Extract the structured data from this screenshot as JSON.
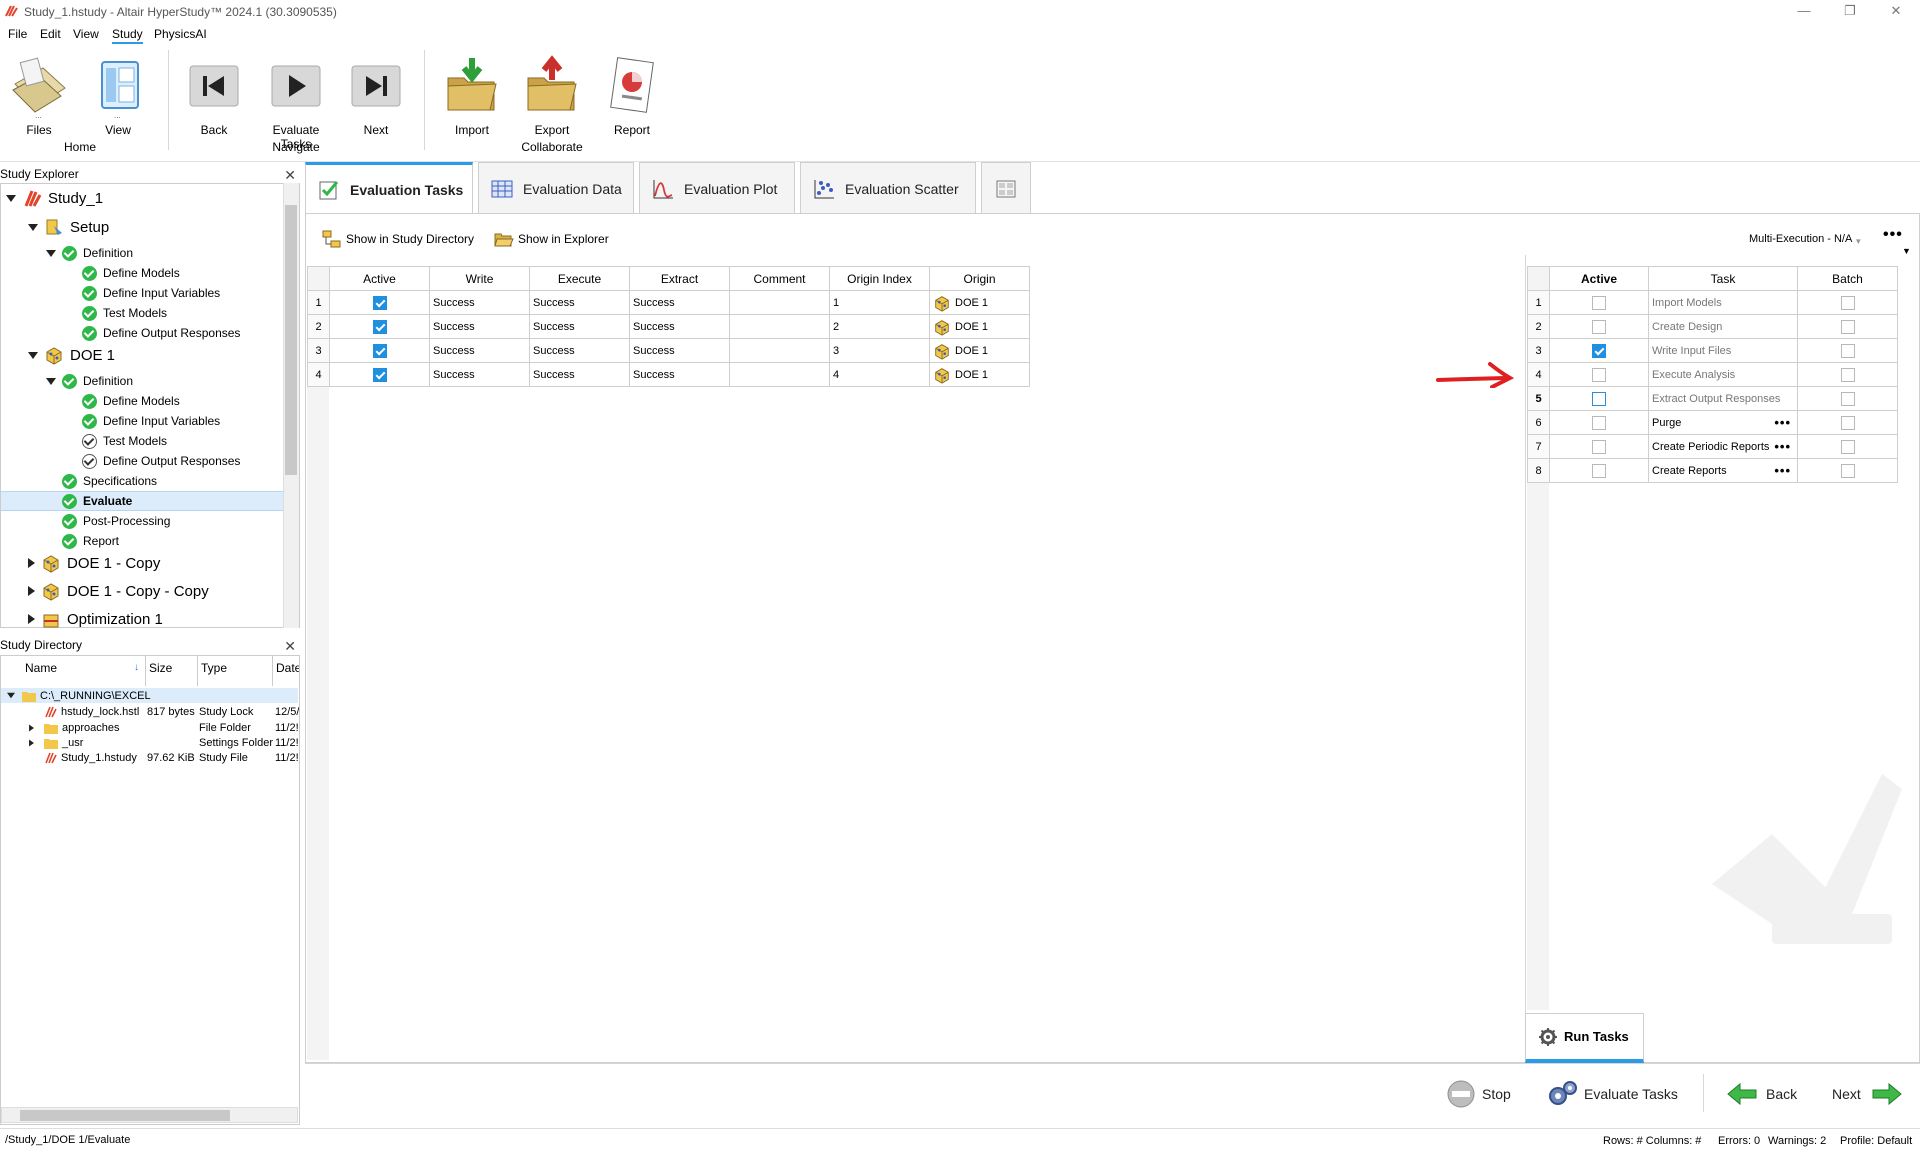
{
  "window": {
    "title": "Study_1.hstudy - Altair HyperStudy™ 2024.1 (30.3090535)",
    "controls": [
      "—",
      "❐",
      "✕"
    ]
  },
  "menu": [
    "File",
    "Edit",
    "View",
    "Study",
    "PhysicsAI"
  ],
  "ribbon": {
    "files": "Files",
    "view": "View",
    "home_group": "Home",
    "back": "Back",
    "evaluate_tasks": "Evaluate Tasks",
    "next": "Next",
    "navigate_group": "Navigate",
    "import": "Import",
    "export": "Export",
    "report": "Report",
    "collaborate_group": "Collaborate"
  },
  "explorer": {
    "header": "Study Explorer",
    "study": "Study_1",
    "setup": "Setup",
    "setup_definition": "Definition",
    "setup_items": [
      "Define Models",
      "Define Input Variables",
      "Test Models",
      "Define Output Responses"
    ],
    "doe": "DOE 1",
    "doe_definition": "Definition",
    "doe_items": [
      "Define Models",
      "Define Input Variables",
      "Test Models",
      "Define Output Responses"
    ],
    "specifications": "Specifications",
    "evaluate": "Evaluate",
    "post": "Post-Processing",
    "report": "Report",
    "doe_copy": "DOE 1 - Copy",
    "doe_copy_copy": "DOE 1 - Copy - Copy",
    "optimization": "Optimization 1"
  },
  "directory": {
    "header": "Study Directory",
    "columns": [
      "Name",
      "Size",
      "Type",
      "Date"
    ],
    "root": "C:\\_RUNNING\\EXCEL",
    "files": [
      {
        "name": "hstudy_lock.hstl",
        "size": "817 bytes",
        "type": "Study Lock",
        "date": "12/5/"
      },
      {
        "name": "approaches",
        "size": "",
        "type": "File Folder",
        "date": "11/2!"
      },
      {
        "name": "_usr",
        "size": "",
        "type": "Settings Folder",
        "date": "11/2!"
      },
      {
        "name": "Study_1.hstudy",
        "size": "97.62 KiB",
        "type": "Study File",
        "date": "11/2!"
      }
    ]
  },
  "tabs": [
    "Evaluation Tasks",
    "Evaluation Data",
    "Evaluation Plot",
    "Evaluation Scatter"
  ],
  "toolbar": {
    "show_study_dir": "Show in Study Directory",
    "show_explorer": "Show in Explorer",
    "multi_exec": "Multi-Execution - N/A"
  },
  "eval_table": {
    "columns": [
      "Active",
      "Write",
      "Execute",
      "Extract",
      "Comment",
      "Origin Index",
      "Origin"
    ],
    "rows": [
      {
        "n": "1",
        "write": "Success",
        "execute": "Success",
        "extract": "Success",
        "comment": "",
        "index": "1",
        "origin": "DOE 1"
      },
      {
        "n": "2",
        "write": "Success",
        "execute": "Success",
        "extract": "Success",
        "comment": "",
        "index": "2",
        "origin": "DOE 1"
      },
      {
        "n": "3",
        "write": "Success",
        "execute": "Success",
        "extract": "Success",
        "comment": "",
        "index": "3",
        "origin": "DOE 1"
      },
      {
        "n": "4",
        "write": "Success",
        "execute": "Success",
        "extract": "Success",
        "comment": "",
        "index": "4",
        "origin": "DOE 1"
      }
    ]
  },
  "task_table": {
    "columns": [
      "Active",
      "Task",
      "Batch"
    ],
    "rows": [
      {
        "n": "1",
        "task": "Import Models",
        "active": false
      },
      {
        "n": "2",
        "task": "Create Design",
        "active": false
      },
      {
        "n": "3",
        "task": "Write Input Files",
        "active": true
      },
      {
        "n": "4",
        "task": "Execute Analysis",
        "active": false
      },
      {
        "n": "5",
        "task": "Extract Output Responses",
        "active": false
      },
      {
        "n": "6",
        "task": "Purge",
        "active": false
      },
      {
        "n": "7",
        "task": "Create Periodic Reports",
        "active": false
      },
      {
        "n": "8",
        "task": "Create Reports",
        "active": false
      }
    ]
  },
  "run_tasks": "Run Tasks",
  "bottom": {
    "stop": "Stop",
    "evaluate_tasks": "Evaluate Tasks",
    "back": "Back",
    "next": "Next"
  },
  "status": {
    "path": "/Study_1/DOE 1/Evaluate",
    "rows_cols": "Rows: #  Columns: #",
    "errors": "Errors: 0",
    "warnings": "Warnings: 2",
    "profile": "Profile: Default"
  },
  "colors": {
    "accent": "#2a9be6",
    "ok": "#2fb84a",
    "annotation_arrow": "#e02020"
  }
}
